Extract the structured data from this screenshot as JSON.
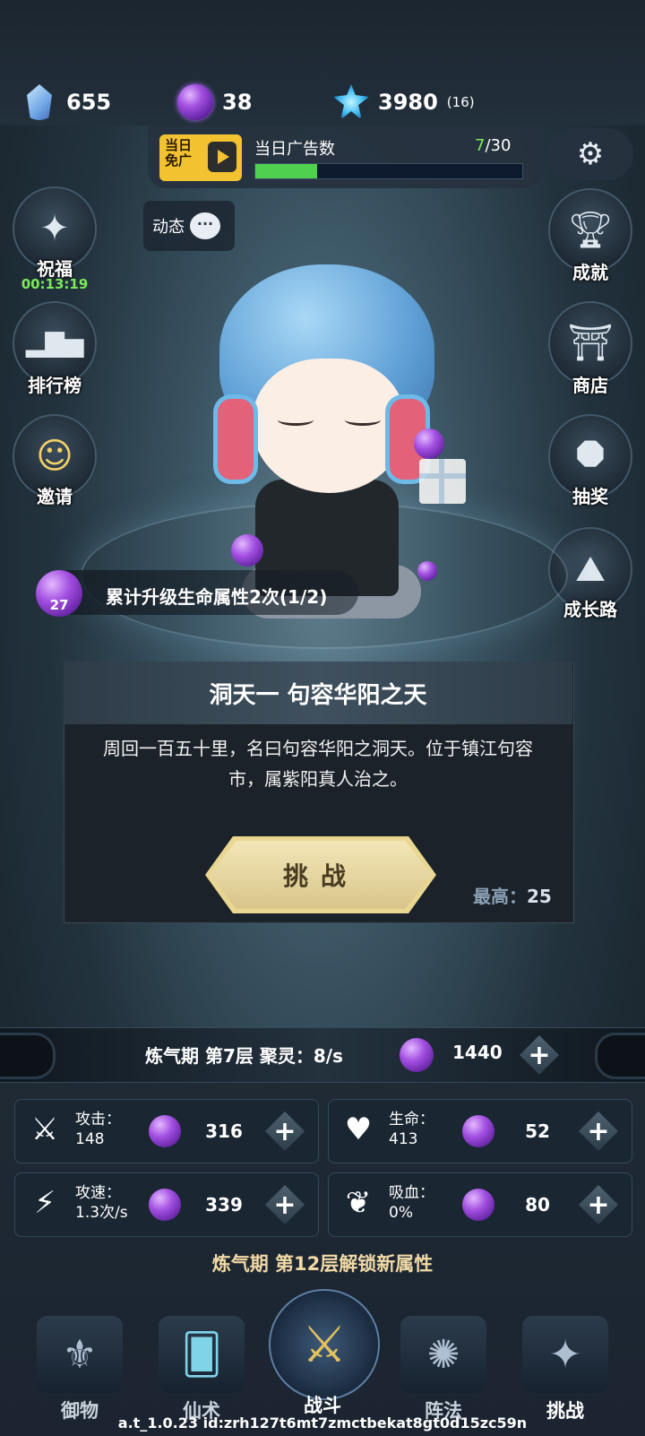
{
  "currencies": [
    {
      "icon": "crystal-icon",
      "value": "655"
    },
    {
      "icon": "purple-orb-icon",
      "value": "38"
    },
    {
      "icon": "spirit-stone-icon",
      "value": "3980",
      "extra": "(16)"
    }
  ],
  "ad": {
    "badge": "当日\n免广",
    "label": "当日广告数",
    "current": "7",
    "total": "/30",
    "progress": 0.233
  },
  "side_left": [
    {
      "label": "祝福",
      "timer": "00:13:19",
      "icon": "blessing-icon"
    },
    {
      "label": "排行榜",
      "icon": "podium-icon"
    },
    {
      "label": "邀请",
      "icon": "invite-icon"
    }
  ],
  "side_right": [
    {
      "label": "成就",
      "icon": "trophy-icon"
    },
    {
      "label": "商店",
      "icon": "shop-icon"
    },
    {
      "label": "抽奖",
      "icon": "lottery-icon"
    },
    {
      "label": "成长路",
      "icon": "mountain-icon"
    }
  ],
  "dongtai": "动态",
  "quest": {
    "level": "27",
    "text": "累计升级生命属性2次(1/2)"
  },
  "stage": {
    "title": "洞天一 句容华阳之天",
    "desc": "周回一百五十里，名曰句容华阳之洞天。位于镇江句容市，属紫阳真人治之。",
    "button": "挑战",
    "best_label": "最高：",
    "best_value": "25"
  },
  "cultivation": {
    "text": "炼气期 第7层 聚灵：8/s",
    "value": "1440"
  },
  "stats": [
    {
      "name": "攻击：",
      "sub": "148",
      "cost": "316",
      "icon": "sword-icon"
    },
    {
      "name": "生命：",
      "sub": "413",
      "cost": "52",
      "icon": "heart-icon"
    },
    {
      "name": "攻速：",
      "sub": "1.3次/s",
      "cost": "339",
      "icon": "speed-icon"
    },
    {
      "name": "吸血：",
      "sub": "0%",
      "cost": "80",
      "icon": "lifesteal-icon"
    }
  ],
  "unlock": "炼气期 第12层解锁新属性",
  "nav": [
    {
      "label": "御物",
      "icon": "weapon-icon"
    },
    {
      "label": "仙术",
      "icon": "card-icon"
    },
    {
      "label": "战斗",
      "icon": "battle-icon"
    },
    {
      "label": "阵法",
      "icon": "formation-icon"
    },
    {
      "label": "挑战",
      "icon": "challenge-icon"
    }
  ],
  "footer": "a.t_1.0.23 id:zrh127t6mt7zmctbekat8gt0d15zc59n"
}
